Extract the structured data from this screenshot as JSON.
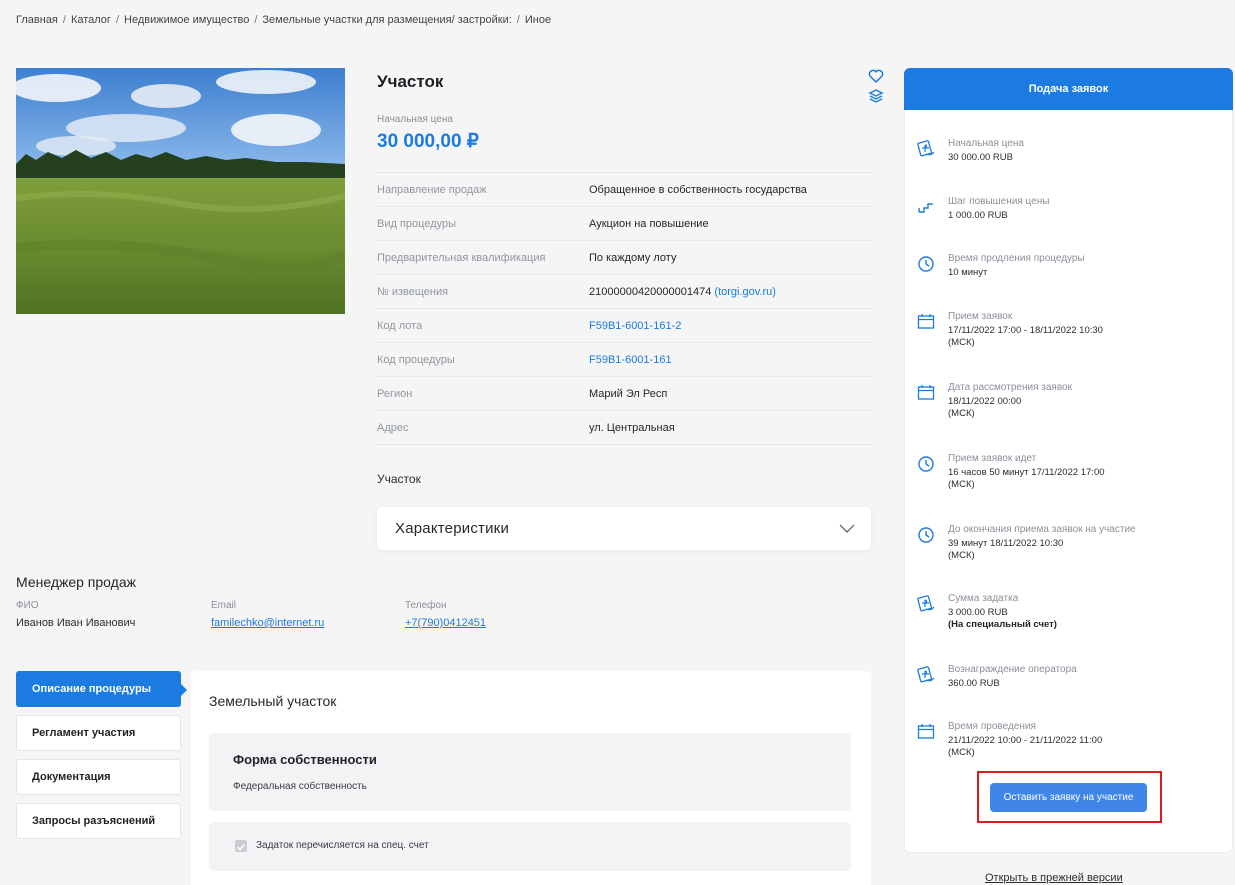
{
  "breadcrumb": [
    "Главная",
    "Каталог",
    "Недвижимое имущество",
    "Земельные участки для размещения/ застройки:",
    "Иное"
  ],
  "lot": {
    "title": "Участок",
    "price_label": "Начальная цена",
    "price_value": "30 000,00 ₽"
  },
  "details": [
    {
      "key": "Направление продаж",
      "value": "Обращенное в собственность государства"
    },
    {
      "key": "Вид процедуры",
      "value": "Аукцион на повышение"
    },
    {
      "key": "Предварительная квалификация",
      "value": "По каждому лоту"
    },
    {
      "key": "№ извещения",
      "value": "21000000420000001474",
      "source": "(torgi.gov.ru)"
    },
    {
      "key": "Код лота",
      "value": "F59B1-6001-161-2"
    },
    {
      "key": "Код процедуры",
      "value": "F59B1-6001-161"
    },
    {
      "key": "Регион",
      "value": "Марий Эл Респ"
    },
    {
      "key": "Адрес",
      "value": "ул. Центральная"
    }
  ],
  "subsection": "Участок",
  "accordion": {
    "title": "Характеристики"
  },
  "manager": {
    "title": "Менеджер продаж",
    "fio_label": "ФИО",
    "fio": "Иванов Иван Иванович",
    "email_label": "Email",
    "email": "familechko@internet.ru",
    "phone_label": "Телефон",
    "phone": "+7(790)0412451"
  },
  "tabs": [
    "Описание процедуры",
    "Регламент участия",
    "Документация",
    "Запросы разъяснений"
  ],
  "description": {
    "title": "Земельный участок",
    "form_title": "Форма собственности",
    "form_value": "Федеральная собственность",
    "checkbox_label": "Задаток перечисляется на спец. счет"
  },
  "sidebar": {
    "header": "Подача заявок",
    "items": [
      {
        "icon": "money-icon",
        "label": "Начальная цена",
        "lines": [
          "30 000.00 RUB"
        ]
      },
      {
        "icon": "step-icon",
        "label": "Шаг повышения цены",
        "lines": [
          "1 000.00 RUB"
        ]
      },
      {
        "icon": "clock-icon",
        "label": "Время продления процедуры",
        "lines": [
          "10 минут"
        ]
      },
      {
        "icon": "calendar-icon",
        "label": "Прием заявок",
        "lines": [
          "17/11/2022 17:00  - 18/11/2022 10:30",
          "(МСК)"
        ]
      },
      {
        "icon": "calendar-icon",
        "label": "Дата рассмотрения заявок",
        "lines": [
          "18/11/2022 00:00",
          "(МСК)"
        ]
      },
      {
        "icon": "clock-icon",
        "label": "Прием заявок идет",
        "lines": [
          "16 часов 50 минут 17/11/2022 17:00",
          "(МСК)"
        ]
      },
      {
        "icon": "clock-icon",
        "label": "До окончания приема заявок на участие",
        "lines": [
          "39 минут 18/11/2022 10:30",
          "(МСК)"
        ]
      },
      {
        "icon": "money-icon",
        "label": "Сумма задатка",
        "lines": [
          "3 000.00 RUB"
        ],
        "note": "(На специальный счет)"
      },
      {
        "icon": "money-icon",
        "label": "Вознаграждение оператора",
        "lines": [
          "360.00 RUB"
        ]
      },
      {
        "icon": "calendar-icon",
        "label": "Время проведения",
        "lines": [
          "21/11/2022 10:00 - 21/11/2022 11:00",
          "(МСК)"
        ]
      }
    ],
    "cta": "Оставить заявку на участие"
  },
  "old_version_link": "Открыть в прежней версии",
  "colors": {
    "accent": "#1b7be0",
    "cta": "#3f86e8",
    "highlight": "#d81b1b"
  }
}
